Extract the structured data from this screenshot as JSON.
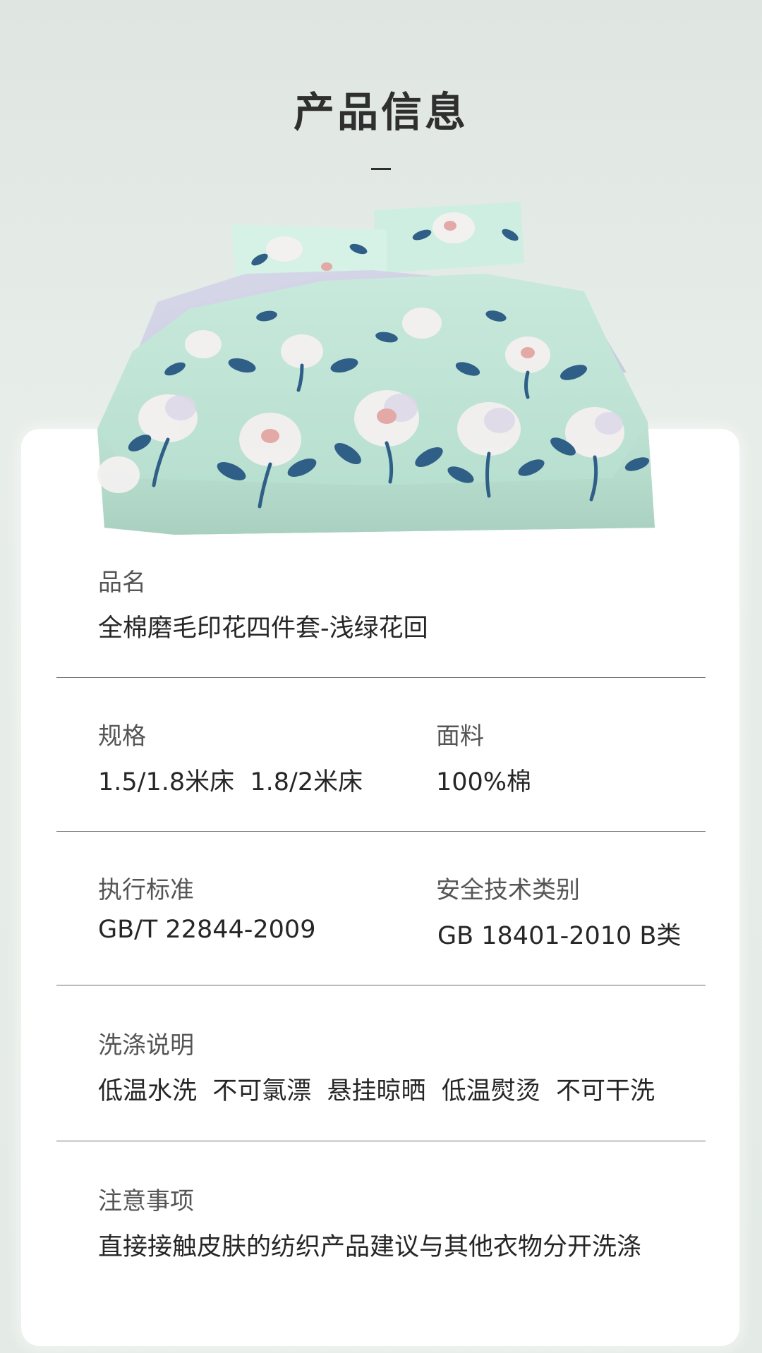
{
  "header": {
    "title": "产品信息"
  },
  "colors": {
    "background": "#e3e9e5",
    "card": "#ffffff",
    "text_primary": "#262626",
    "text_label": "#555555",
    "accent_bedding": "#bfe4d6"
  },
  "product_image": {
    "icon": "bedding-set-photo"
  },
  "info": {
    "name_label": "品名",
    "name_value": "全棉磨毛印花四件套-浅绿花回",
    "spec_label": "规格",
    "spec_value": "1.5/1.8米床  1.8/2米床",
    "fabric_label": "面料",
    "fabric_value": "100%棉",
    "standard_label": "执行标准",
    "standard_value": "GB/T 22844-2009",
    "safety_label": "安全技术类别",
    "safety_value": "GB 18401-2010 B类",
    "wash_label": "洗涤说明",
    "wash_value": "低温水洗  不可氯漂  悬挂晾晒  低温熨烫  不可干洗",
    "notice_label": "注意事项",
    "notice_value": "直接接触皮肤的纺织产品建议与其他衣物分开洗涤"
  }
}
